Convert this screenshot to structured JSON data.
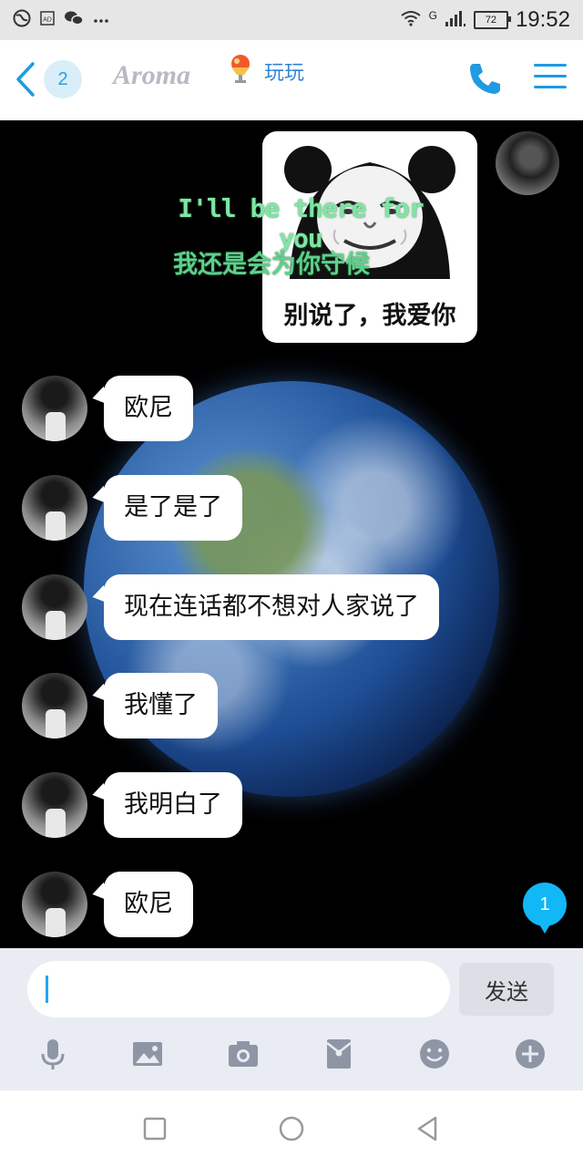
{
  "status_bar": {
    "time": "19:52",
    "battery": "72",
    "network": "G",
    "icons": [
      "globe-icon",
      "ad-icon",
      "wechat-icon",
      "more-icon",
      "wifi-icon",
      "signal-icon",
      "battery-icon"
    ]
  },
  "header": {
    "unread_count": "2",
    "logo_text": "Aroma",
    "contact_name": "玩玩",
    "accent_color": "#1e9be2"
  },
  "overlay": {
    "line1": "I'll be there for you",
    "line2": "我还是会为你守候"
  },
  "messages": {
    "sent_sticker_caption": "别说了，我爱你",
    "received": [
      "欧尼",
      "是了是了",
      "现在连话都不想对人家说了",
      "我懂了",
      "我明白了",
      "欧尼"
    ],
    "new_message_count": "1"
  },
  "input": {
    "value": "",
    "send_label": "发送"
  },
  "toolbar": {
    "icons": [
      "microphone-icon",
      "image-icon",
      "camera-icon",
      "red-packet-icon",
      "emoji-icon",
      "plus-icon"
    ]
  },
  "navigation": {
    "icons": [
      "recents-icon",
      "home-icon",
      "back-icon"
    ]
  }
}
